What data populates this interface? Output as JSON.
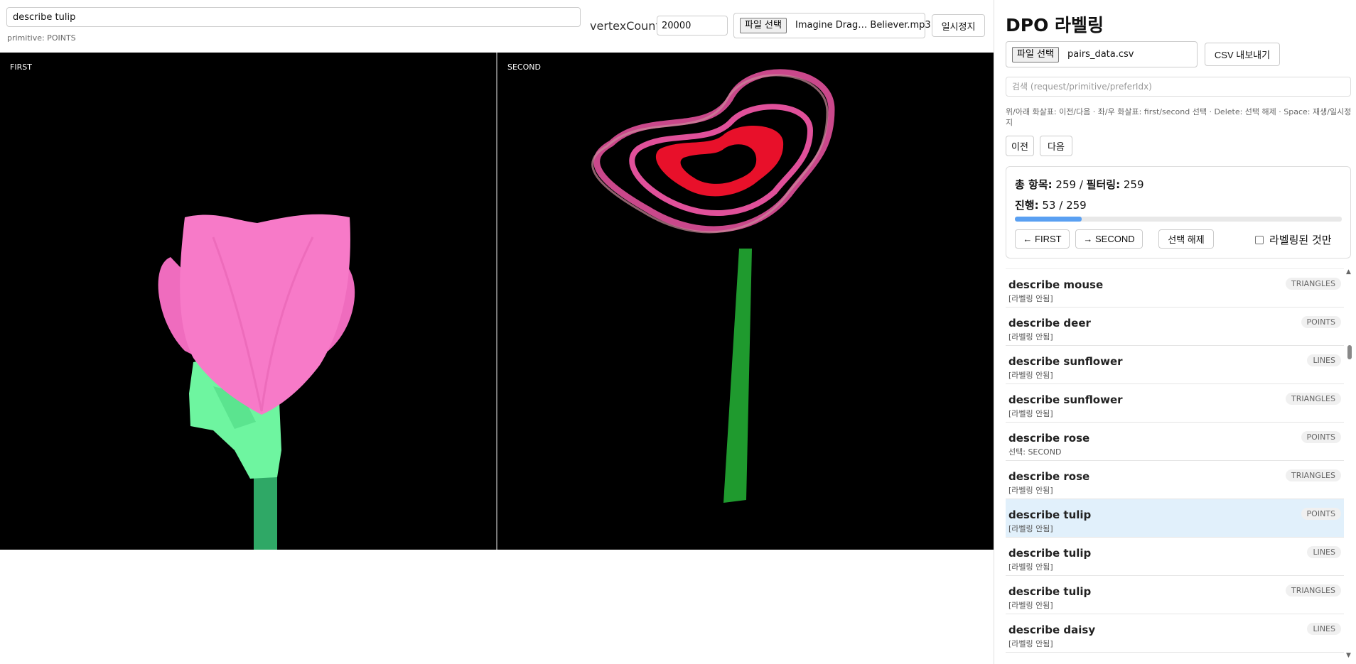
{
  "toolbar": {
    "request_value": "describe tulip",
    "primitive_label": "primitive: POINTS",
    "vertex_count_label": "vertexCount",
    "vertex_count_value": "20000",
    "file_button_label": "파일 선택",
    "audio_file_name": "Imagine Drag… Believer.mp3",
    "pause_label": "일시정지"
  },
  "viewports": {
    "first_label": "FIRST",
    "second_label": "SECOND"
  },
  "colors": {
    "tulip_pink": "#f77ac8",
    "leaf_green": "#6ef5a0",
    "stem_green": "#2fa866",
    "rose_red": "#e8102a",
    "rose_pink": "#e0509a",
    "progress_blue": "#5aa0f2",
    "active_row": "#e1f0fb"
  },
  "panel": {
    "title": "DPO 라벨링",
    "csv_file_button": "파일 선택",
    "csv_file_name": "pairs_data.csv",
    "csv_export_label": "CSV 내보내기",
    "search_placeholder": "검색 (request/primitive/preferIdx)",
    "hint": "위/아래 화살표: 이전/다음 · 좌/우 화살표: first/second 선택 · Delete: 선택 해제 · Space: 재생/일시정지",
    "prev_label": "이전",
    "next_label": "다음",
    "stats": {
      "total_label": "총 항목:",
      "total_value": "259",
      "sep": "/",
      "filtered_label": "필터링:",
      "filtered_value": "259",
      "progress_label": "진행:",
      "progress_text": "53 / 259",
      "progress_fraction": 0.2046,
      "first_btn": "← FIRST",
      "second_btn": "→ SECOND",
      "clear_btn": "선택 해제",
      "only_labeled": "라벨링된 것만"
    },
    "items": [
      {
        "title": "describe mouse",
        "status": "[라벨링 안됨]",
        "badge": "TRIANGLES"
      },
      {
        "title": "describe deer",
        "status": "[라벨링 안됨]",
        "badge": "POINTS"
      },
      {
        "title": "describe sunflower",
        "status": "[라벨링 안됨]",
        "badge": "LINES"
      },
      {
        "title": "describe sunflower",
        "status": "[라벨링 안됨]",
        "badge": "TRIANGLES"
      },
      {
        "title": "describe rose",
        "status": "선택: SECOND",
        "badge": "POINTS"
      },
      {
        "title": "describe rose",
        "status": "[라벨링 안됨]",
        "badge": "TRIANGLES"
      },
      {
        "title": "describe tulip",
        "status": "[라벨링 안됨]",
        "badge": "POINTS",
        "active": true
      },
      {
        "title": "describe tulip",
        "status": "[라벨링 안됨]",
        "badge": "LINES"
      },
      {
        "title": "describe tulip",
        "status": "[라벨링 안됨]",
        "badge": "TRIANGLES"
      },
      {
        "title": "describe daisy",
        "status": "[라벨링 안됨]",
        "badge": "LINES"
      }
    ]
  }
}
